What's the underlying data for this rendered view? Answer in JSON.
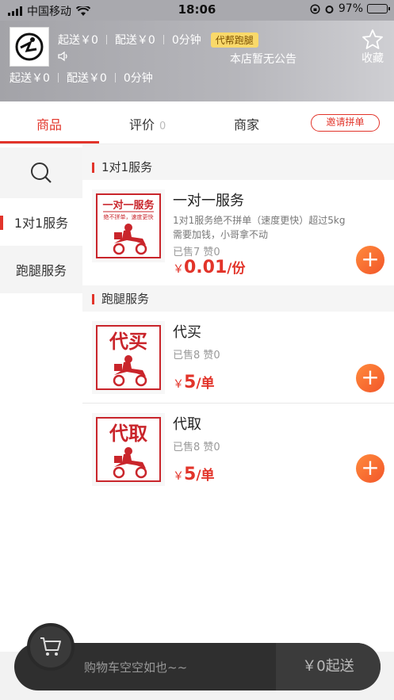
{
  "status": {
    "carrier": "中国移动",
    "time": "18:06",
    "battery": "97%"
  },
  "header": {
    "min_order_1": "起送￥0",
    "delivery_fee_1": "配送￥0",
    "eta_1": "0分钟",
    "tag": "代帮跑腿",
    "notice": "本店暂无公告",
    "fav_label": "收藏",
    "min_order_2": "起送￥0",
    "delivery_fee_2": "配送￥0",
    "eta_2": "0分钟"
  },
  "tabs": {
    "goods": "商品",
    "reviews": "评价",
    "review_count": "0",
    "merchant": "商家",
    "invite": "邀请拼单"
  },
  "sidebar": {
    "items": [
      {
        "label": "1对1服务"
      },
      {
        "label": "跑腿服务"
      }
    ]
  },
  "sections": [
    {
      "title": "1对1服务",
      "products": [
        {
          "name": "一对一服务",
          "desc1": "1对1服务绝不拼单（速度更快）超过5kg",
          "desc2": "需要加钱，小哥拿不动",
          "sold": "已售7  赞0",
          "price_prefix": "￥",
          "price": "0.01",
          "unit": "/份",
          "img_title": "一对一服务",
          "img_sub": "绝不拼单，速度更快"
        }
      ]
    },
    {
      "title": "跑腿服务",
      "products": [
        {
          "name": "代买",
          "sold": "已售8  赞0",
          "price_prefix": "￥",
          "price": "5",
          "unit": "/单",
          "img_title": "代买"
        },
        {
          "name": "代取",
          "sold": "已售8  赞0",
          "price_prefix": "￥",
          "price": "5",
          "unit": "/单",
          "img_title": "代取"
        }
      ]
    }
  ],
  "cart": {
    "empty_text": "购物车空空如也~~",
    "checkout": "￥0起送"
  },
  "colors": {
    "accent": "#e2342a",
    "add_button": "#f2562a",
    "header_bg": "#a9a9ae"
  }
}
